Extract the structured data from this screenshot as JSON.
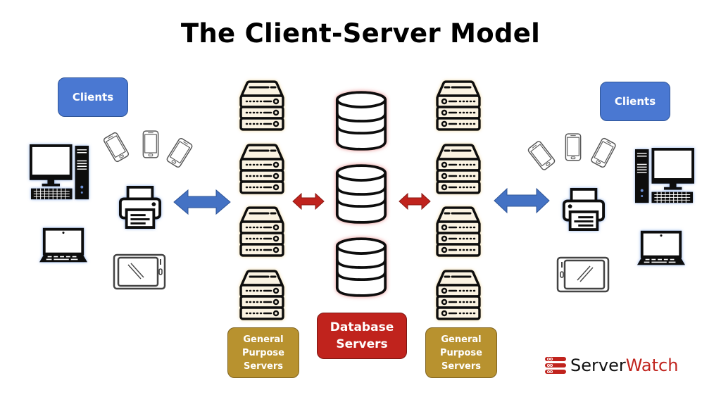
{
  "title": "The Client-Server Model",
  "left_clients": {
    "label": "Clients",
    "devices": [
      "desktop-computer",
      "smartphone",
      "smartphone",
      "smartphone",
      "printer",
      "laptop",
      "tablet"
    ]
  },
  "right_clients": {
    "label": "Clients",
    "devices": [
      "desktop-computer",
      "smartphone",
      "smartphone",
      "smartphone",
      "printer",
      "laptop",
      "tablet"
    ]
  },
  "general_purpose_servers": {
    "left_label_lines": [
      "General",
      "Purpose",
      "Servers"
    ],
    "right_label_lines": [
      "General",
      "Purpose",
      "Servers"
    ],
    "count_per_side": 4
  },
  "database_servers": {
    "label_lines": [
      "Database",
      "Servers"
    ],
    "count": 3
  },
  "connections": [
    {
      "from": "left-clients",
      "to": "left-general-purpose-servers",
      "type": "bidirectional",
      "color": "#4472c4"
    },
    {
      "from": "left-general-purpose-servers",
      "to": "database-servers",
      "type": "bidirectional",
      "color": "#c0231d"
    },
    {
      "from": "database-servers",
      "to": "right-general-purpose-servers",
      "type": "bidirectional",
      "color": "#c0231d"
    },
    {
      "from": "right-general-purpose-servers",
      "to": "right-clients",
      "type": "bidirectional",
      "color": "#4472c4"
    }
  ],
  "colors": {
    "clients": "#4a78d2",
    "general_purpose": "#b8922f",
    "database": "#c0231d",
    "server_fill": "#fbf3e2",
    "db_glow": "#f2b4b4"
  },
  "logo": {
    "part1": "Server",
    "part2": "Watch"
  }
}
